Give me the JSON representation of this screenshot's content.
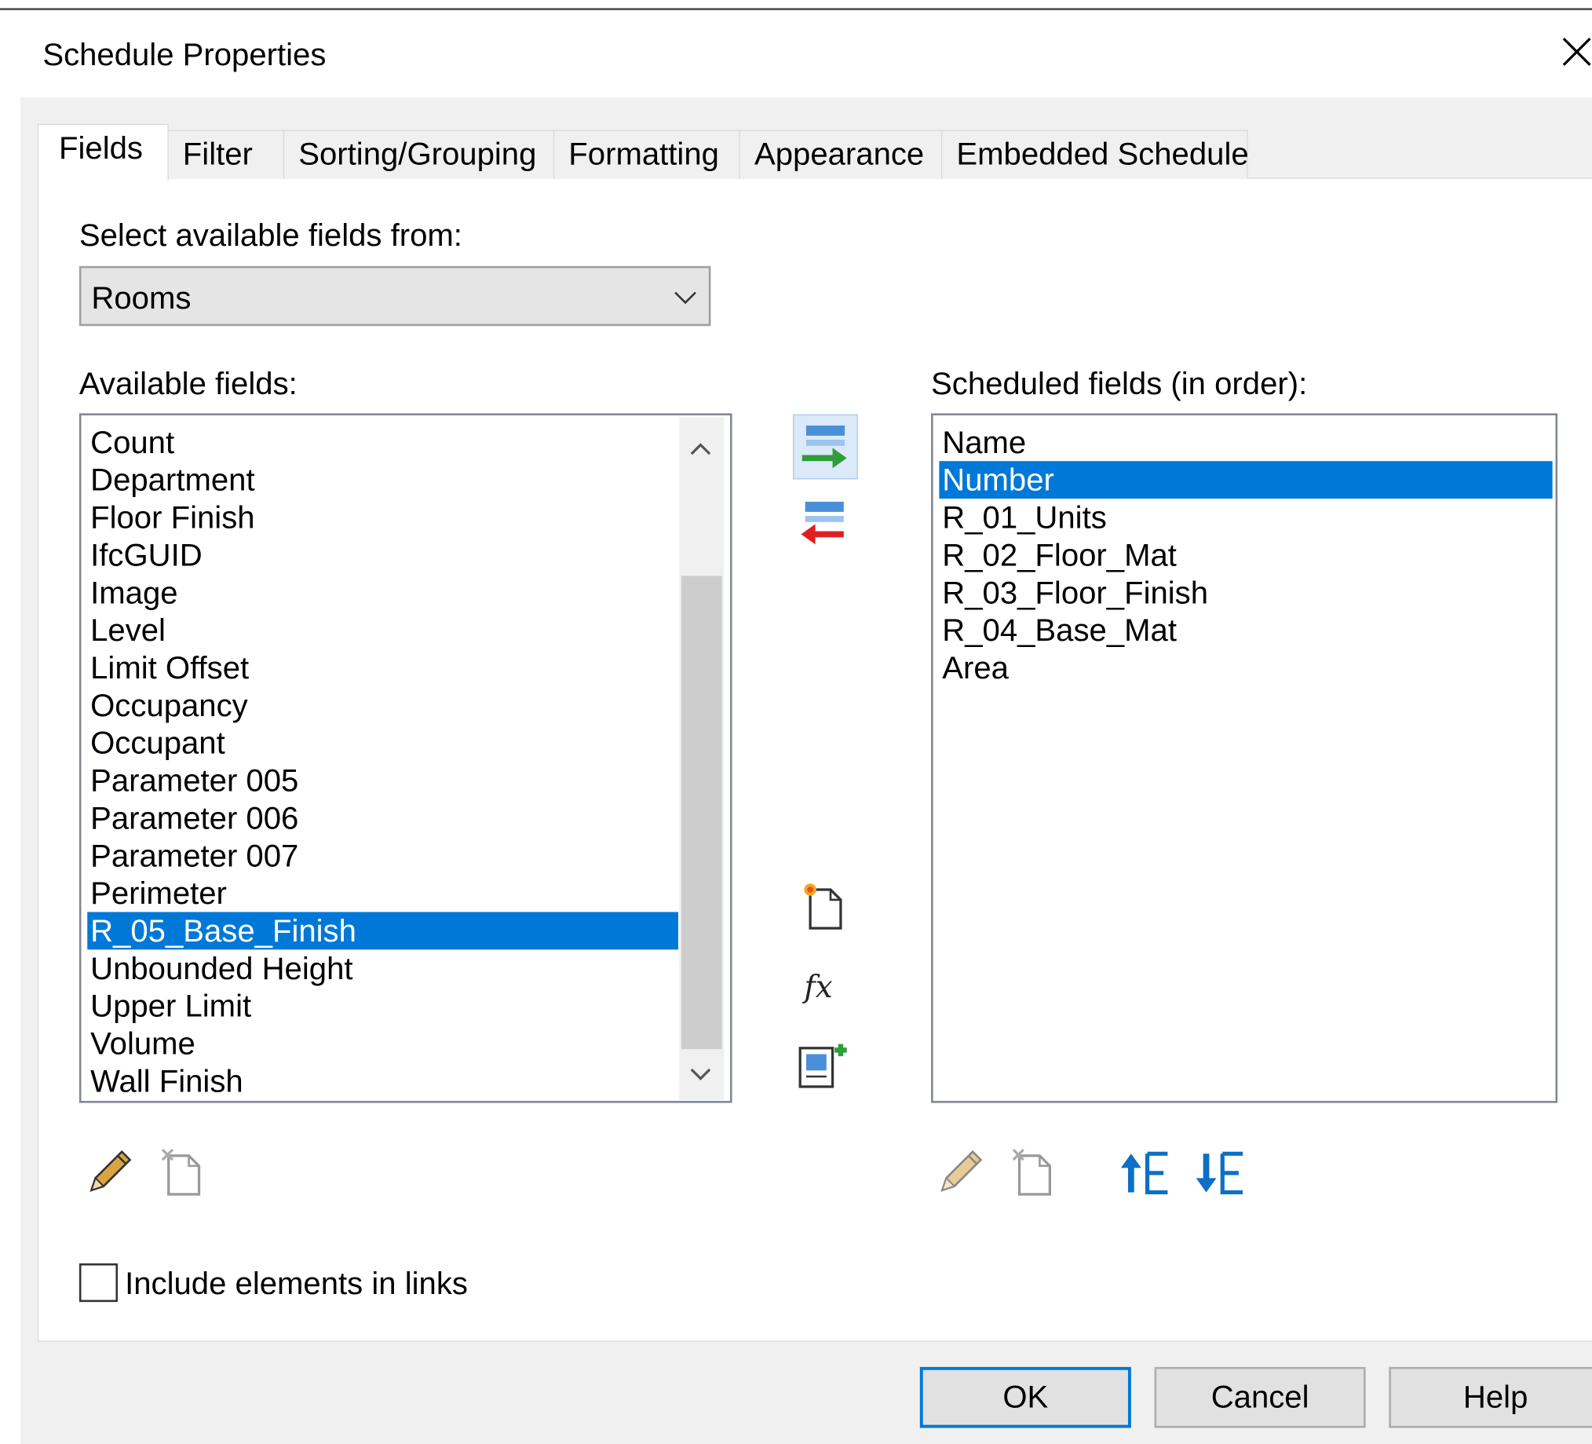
{
  "window": {
    "title": "Schedule Properties"
  },
  "tabs": [
    {
      "label": "Fields",
      "active": true
    },
    {
      "label": "Filter"
    },
    {
      "label": "Sorting/Grouping"
    },
    {
      "label": "Formatting"
    },
    {
      "label": "Appearance"
    },
    {
      "label": "Embedded Schedule"
    }
  ],
  "source": {
    "label": "Select available fields from:",
    "selected": "Rooms"
  },
  "available": {
    "label": "Available fields:",
    "items": [
      "Count",
      "Department",
      "Floor Finish",
      "IfcGUID",
      "Image",
      "Level",
      "Limit Offset",
      "Occupancy",
      "Occupant",
      "Parameter 005",
      "Parameter 006",
      "Parameter 007",
      "Perimeter",
      "R_05_Base_Finish",
      "Unbounded Height",
      "Upper Limit",
      "Volume",
      "Wall Finish"
    ],
    "selected": "R_05_Base_Finish"
  },
  "scheduled": {
    "label": "Scheduled fields (in order):",
    "items": [
      "Name",
      "Number",
      "R_01_Units",
      "R_02_Floor_Mat",
      "R_03_Floor_Finish",
      "R_04_Base_Mat",
      "Area"
    ],
    "selected": "Number"
  },
  "options": {
    "include_links_label": "Include elements in links",
    "include_links_checked": false
  },
  "buttons": {
    "ok": "OK",
    "cancel": "Cancel",
    "help": "Help"
  },
  "icons": {
    "close": "close-icon",
    "add": "add-parameter-icon",
    "remove": "remove-parameter-icon",
    "new_param": "new-parameter-icon",
    "formula": "calculated-value-icon",
    "combine": "combine-parameters-icon",
    "edit": "pencil-icon",
    "delete": "delete-parameter-icon",
    "move_up": "move-up-icon",
    "move_down": "move-down-icon"
  },
  "colors": {
    "selection": "#0078d7",
    "dialog_bg": "#f0f0f0",
    "accent_green": "#2e9d3a",
    "accent_red": "#e02020"
  }
}
